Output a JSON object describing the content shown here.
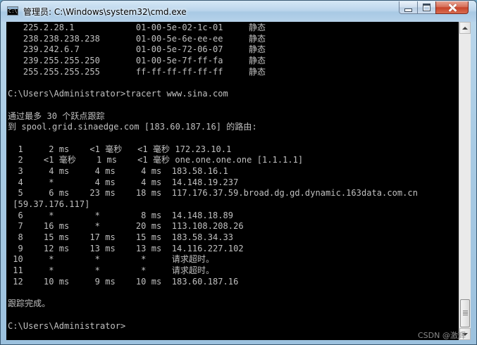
{
  "window": {
    "title": "管理员: C:\\Windows\\system32\\cmd.exe",
    "icon": "cmd-icon",
    "icon_text": "C:\\",
    "controls": {
      "minimize": "minimize-icon",
      "maximize": "maximize-icon",
      "close": "close-icon"
    }
  },
  "console": {
    "foreground": "#c0c0c0",
    "background": "#000000",
    "lines": [
      "   225.2.28.1            01-00-5e-02-1c-01     静态",
      "   238.238.238.238       01-00-5e-6e-ee-ee     静态",
      "   239.242.6.7           01-00-5e-72-06-07     静态",
      "   239.255.255.250       01-00-5e-7f-ff-fa     静态",
      "   255.255.255.255       ff-ff-ff-ff-ff-ff     静态",
      "",
      "C:\\Users\\Administrator>tracert www.sina.com",
      "",
      "通过最多 30 个跃点跟踪",
      "到 spool.grid.sinaedge.com [183.60.187.16] 的路由:",
      "",
      "  1     2 ms    <1 毫秒   <1 毫秒 172.23.10.1",
      "  2    <1 毫秒    1 ms    <1 毫秒 one.one.one.one [1.1.1.1]",
      "  3     4 ms     4 ms     4 ms  183.58.16.1",
      "  4     *        4 ms     4 ms  14.148.19.237",
      "  5     6 ms    23 ms    18 ms  117.176.37.59.broad.dg.gd.dynamic.163data.com.cn",
      " [59.37.176.117]",
      "  6     *        *        8 ms  14.148.18.89",
      "  7    16 ms     *       20 ms  113.108.208.26",
      "  8    15 ms    17 ms    15 ms  183.58.34.33",
      "  9    12 ms    13 ms    13 ms  14.116.227.102",
      " 10     *        *        *     请求超时。",
      " 11     *        *        *     请求超时。",
      " 12    10 ms     9 ms    10 ms  183.60.187.16",
      "",
      "跟踪完成。",
      "",
      "C:\\Users\\Administrator>"
    ]
  },
  "watermark": "CSDN @激辉"
}
